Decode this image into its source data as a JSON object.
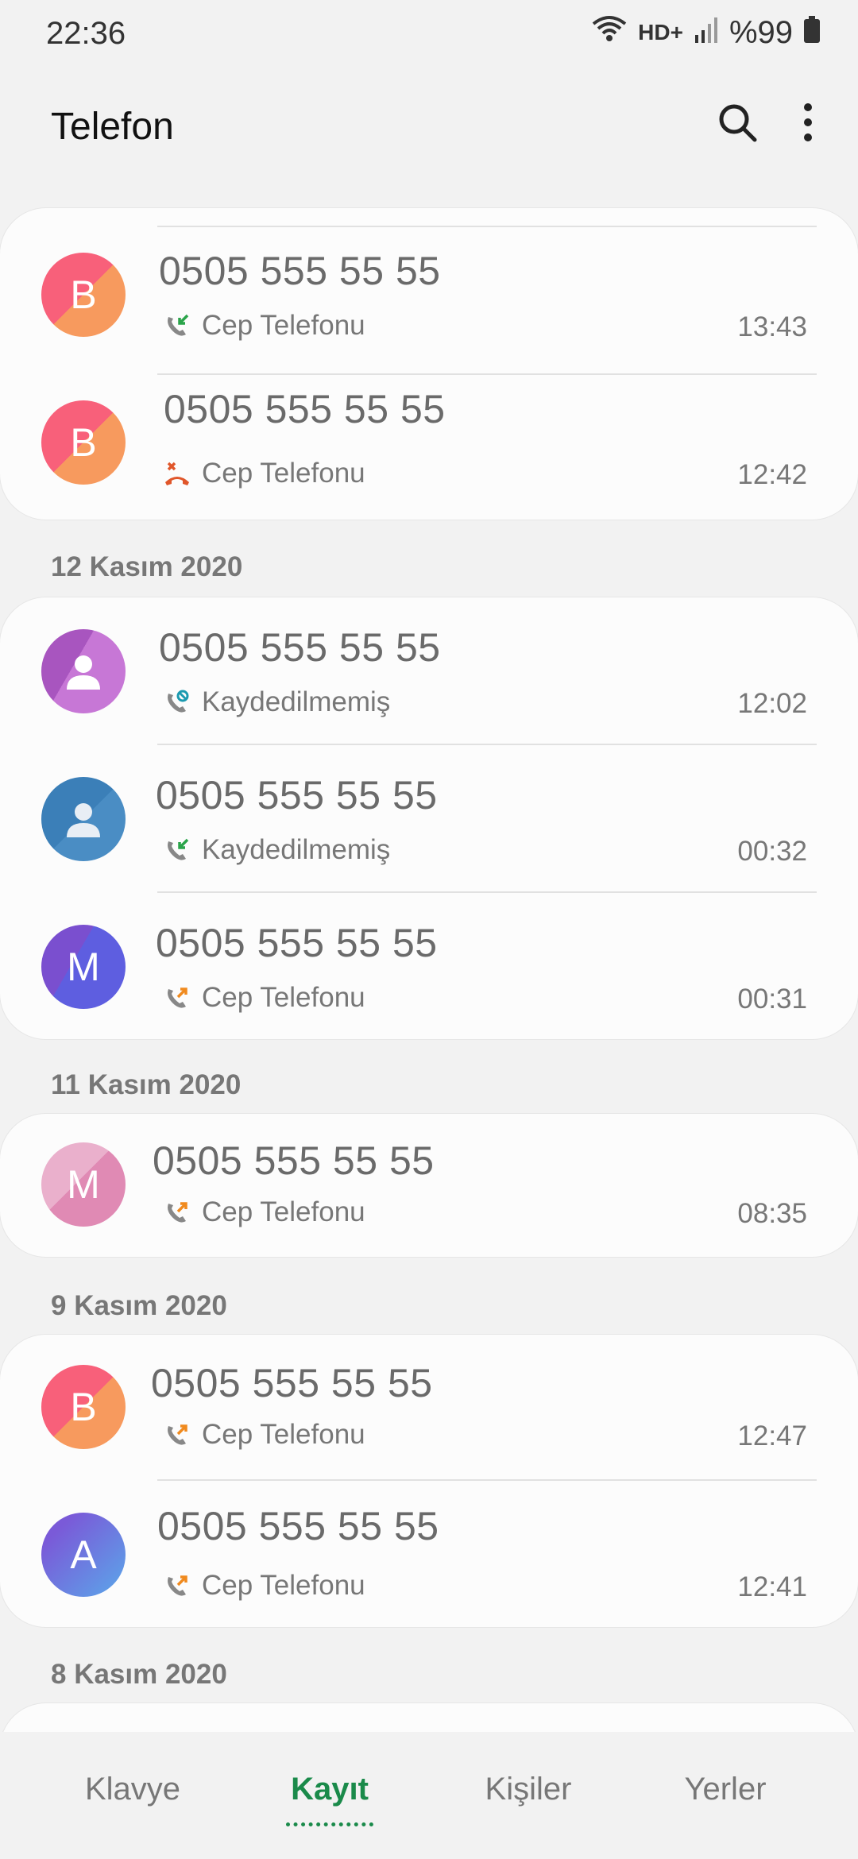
{
  "status": {
    "time": "22:36",
    "network": "HD+",
    "battery": "%99"
  },
  "app": {
    "title": "Telefon"
  },
  "sections": [
    {
      "header": "",
      "calls": [
        {
          "avatar": "B",
          "avatar_style": "coral",
          "number": "0505 555 55 55",
          "type_icon": "incoming-call-icon",
          "type": "Cep Telefonu",
          "time": "13:43"
        },
        {
          "avatar": "B",
          "avatar_style": "coral",
          "number": "0505 555 55 55",
          "type_icon": "rejected-call-icon",
          "type": "Cep Telefonu",
          "time": "12:42"
        }
      ]
    },
    {
      "header": "12 Kasım 2020",
      "calls": [
        {
          "avatar": "",
          "avatar_style": "purple-person",
          "number": "0505 555 55 55",
          "type_icon": "blocked-call-icon",
          "type": "Kaydedilmemiş",
          "time": "12:02"
        },
        {
          "avatar": "",
          "avatar_style": "blue-person",
          "number": "0505 555 55 55",
          "type_icon": "incoming-call-icon",
          "type": "Kaydedilmemiş",
          "time": "00:32"
        },
        {
          "avatar": "M",
          "avatar_style": "indigo",
          "number": "0505 555 55 55",
          "type_icon": "outgoing-call-icon",
          "type": "Cep Telefonu",
          "time": "00:31"
        }
      ]
    },
    {
      "header": "11 Kasım 2020",
      "calls": [
        {
          "avatar": "M",
          "avatar_style": "pink",
          "number": "0505 555 55 55",
          "type_icon": "outgoing-call-icon",
          "type": "Cep Telefonu",
          "time": "08:35"
        }
      ]
    },
    {
      "header": "9 Kasım 2020",
      "calls": [
        {
          "avatar": "B",
          "avatar_style": "coral",
          "number": "0505 555 55 55",
          "type_icon": "outgoing-call-icon",
          "type": "Cep Telefonu",
          "time": "12:47"
        },
        {
          "avatar": "A",
          "avatar_style": "blue-violet",
          "number": "0505 555 55 55",
          "type_icon": "outgoing-call-icon",
          "type": "Cep Telefonu",
          "time": "12:41"
        }
      ]
    },
    {
      "header": "8 Kasım 2020",
      "calls": []
    }
  ],
  "bottom_nav": {
    "tabs": [
      {
        "label": "Klavye",
        "active": false
      },
      {
        "label": "Kayıt",
        "active": true
      },
      {
        "label": "Kişiler",
        "active": false
      },
      {
        "label": "Yerler",
        "active": false
      }
    ]
  },
  "colors": {
    "accent": "#1a8a4a",
    "incoming": "#2aa44a",
    "outgoing": "#f08a1e",
    "rejected": "#e0562a",
    "blocked": "#1b9ab0",
    "coral_a": "#f8607a",
    "coral_b": "#f79a5e",
    "purple_a": "#b05ec6",
    "purple_b": "#c777d6",
    "blue_a": "#3b7fb8",
    "blue_b": "#5a9ad0",
    "indigo_a": "#6b4fcf",
    "indigo_b": "#5e5ee0",
    "pink_a": "#e6a6c6",
    "pink_b": "#e08ab4",
    "bv_a": "#7a5ad8",
    "bv_b": "#5aa8ea"
  }
}
